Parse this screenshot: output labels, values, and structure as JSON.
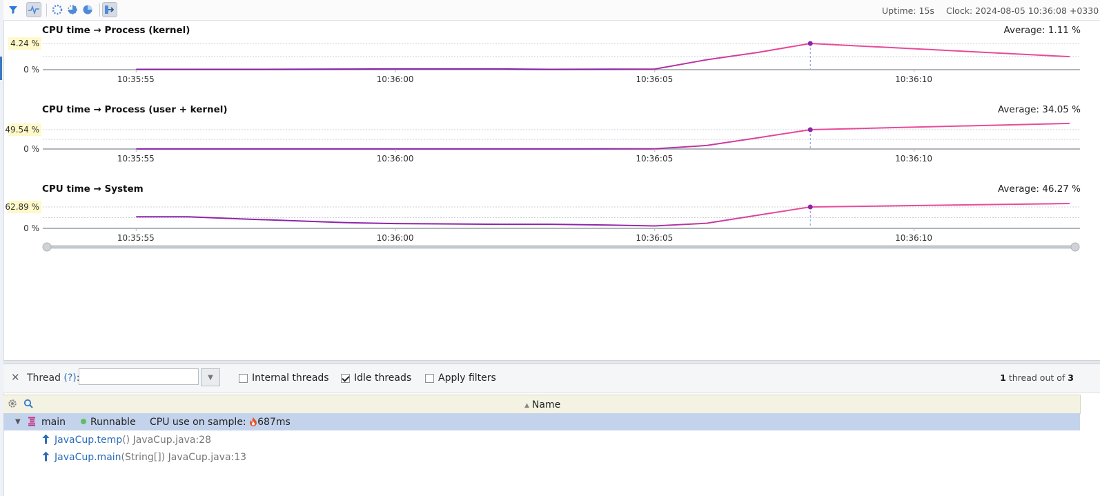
{
  "toolbar": {
    "icons": [
      "filter-icon",
      "wave-icon",
      "spinner-icon-1",
      "spinner-icon-2",
      "pie-icon",
      "export-icon"
    ],
    "uptime": "Uptime: 15s",
    "clock": "Clock: 2024-08-05 10:36:08 +0330"
  },
  "charts": [
    {
      "title": "CPU time → Process (kernel)",
      "average": "Average: 1.11 %",
      "y_top_label": "4.24 %",
      "y_zero_label": "0 %"
    },
    {
      "title": "CPU time → Process (user + kernel)",
      "average": "Average: 34.05 %",
      "y_top_label": "49.54 %",
      "y_zero_label": "0 %"
    },
    {
      "title": "CPU time → System",
      "average": "Average: 46.27 %",
      "y_top_label": "62.89 %",
      "y_zero_label": "0 %"
    }
  ],
  "time_ticks": [
    "10:35:55",
    "10:36:00",
    "10:36:05",
    "10:36:10"
  ],
  "chart_data": [
    {
      "type": "line",
      "title": "CPU time → Process (kernel)",
      "x": [
        "10:35:55",
        "10:35:57",
        "10:35:59",
        "10:36:00",
        "10:36:02",
        "10:36:03",
        "10:36:05",
        "10:36:06",
        "10:36:07",
        "10:36:08",
        "10:36:13"
      ],
      "values": [
        0.05,
        0.05,
        0.1,
        0.12,
        0.12,
        0.05,
        0.1,
        1.6,
        2.8,
        4.24,
        2.1
      ],
      "highlight": "10:36:08",
      "line_colors": [
        "#8e24aa",
        "#e84a9a"
      ]
    },
    {
      "type": "line",
      "title": "CPU time → Process (user + kernel)",
      "x": [
        "10:35:55",
        "10:35:57",
        "10:35:59",
        "10:36:00",
        "10:36:02",
        "10:36:03",
        "10:36:05",
        "10:36:06",
        "10:36:07",
        "10:36:08",
        "10:36:13"
      ],
      "values": [
        0.3,
        0.3,
        0.3,
        0.3,
        0.3,
        0.3,
        0.4,
        9,
        29,
        49.54,
        65.71
      ],
      "highlight": "10:36:08",
      "line_colors": [
        "#8e24aa",
        "#e84a9a"
      ]
    },
    {
      "type": "line",
      "title": "CPU time → System",
      "x": [
        "10:35:55",
        "10:35:56",
        "10:35:57",
        "10:35:59",
        "10:36:00",
        "10:36:02",
        "10:36:03",
        "10:36:04",
        "10:36:05",
        "10:36:06",
        "10:36:08",
        "10:36:13"
      ],
      "values": [
        34,
        34,
        28,
        17,
        14,
        12,
        12,
        10,
        7,
        15,
        62.89,
        73
      ],
      "highlight": "10:36:08",
      "line_colors": [
        "#8e24aa",
        "#e84a9a"
      ]
    }
  ],
  "filter": {
    "thread_label": "Thread",
    "help": "(?)",
    "colon": ":",
    "input_value": "",
    "internal_threads": {
      "label": "Internal threads",
      "checked": false
    },
    "idle_threads": {
      "label": "Idle threads",
      "checked": true
    },
    "apply_filters": {
      "label": "Apply filters",
      "checked": false
    },
    "count_num": "1",
    "count_mid": "thread out of",
    "count_total": "3"
  },
  "table": {
    "column": "Name",
    "thread": {
      "name": "main",
      "state": "Runnable",
      "cpu_label": "CPU use on sample:",
      "cpu_value": "687ms"
    },
    "frames": [
      {
        "method": "JavaCup.temp",
        "args": "()",
        "location": "JavaCup.java:28"
      },
      {
        "method": "JavaCup.main",
        "args": "(String[])",
        "location": "JavaCup.java:13"
      }
    ]
  },
  "colors": {
    "accent": "#2a6cb8",
    "selected_row": "#c3d3ec",
    "series_start": "#8e24aa",
    "series_end": "#e84a9a"
  }
}
